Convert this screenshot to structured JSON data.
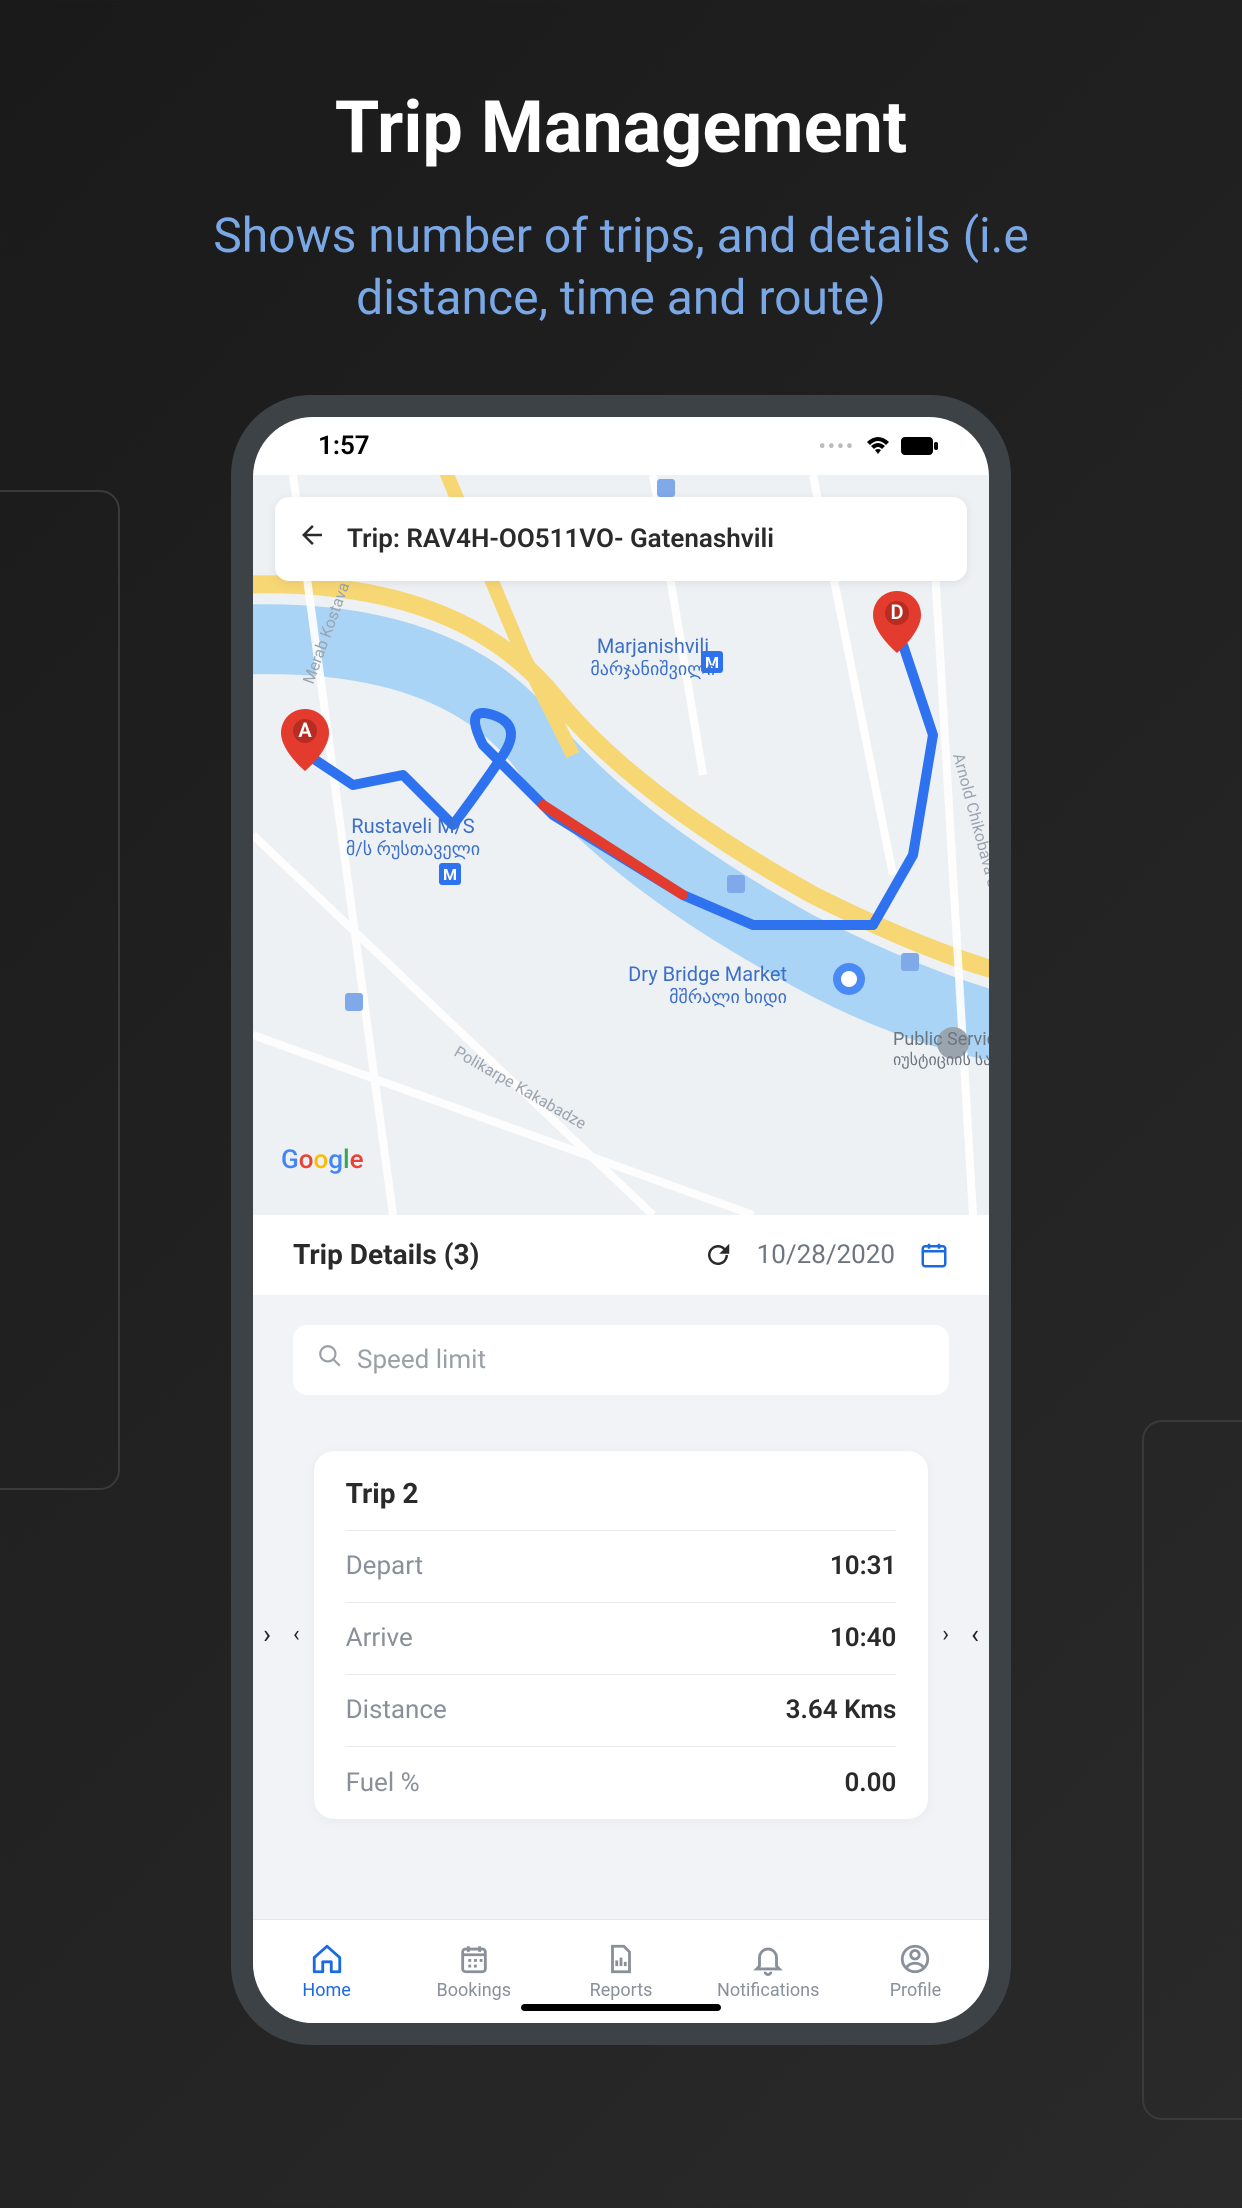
{
  "promo": {
    "title": "Trip Management",
    "subtitle": "Shows number of trips, and details (i.e distance, time and route)"
  },
  "status": {
    "time": "1:57"
  },
  "header": {
    "trip_title": "Trip: RAV4H-OO511VO- Gatenashvili"
  },
  "map": {
    "marker_a": "A",
    "marker_d": "D",
    "labels": {
      "marjanishvili_en": "Marjanishvili",
      "marjanishvili_ka": "მარჯანიშვილი",
      "rustaveli_en": "Rustaveli M/S",
      "rustaveli_ka": "მ/ს რუსთაველი",
      "drybridge_en": "Dry Bridge Market",
      "drybridge_ka": "მშრალი ხიდი",
      "service_hall_en": "Public Service Hall",
      "service_hall_ka": "იუსტიციის სახლი",
      "kostava": "Merab Kostava St",
      "kabadze": "Polikarpe Kakabadze",
      "chikobava": "Arnold Chikobava St"
    }
  },
  "details": {
    "title": "Trip Details (3)",
    "date": "10/28/2020"
  },
  "search": {
    "placeholder": "Speed limit"
  },
  "trip_card": {
    "title": "Trip 2",
    "rows": [
      {
        "label": "Depart",
        "value": "10:31"
      },
      {
        "label": "Arrive",
        "value": "10:40"
      },
      {
        "label": "Distance",
        "value": "3.64 Kms"
      },
      {
        "label": "Fuel %",
        "value": "0.00"
      }
    ]
  },
  "tabs": [
    {
      "label": "Home"
    },
    {
      "label": "Bookings"
    },
    {
      "label": "Reports"
    },
    {
      "label": "Notifications"
    },
    {
      "label": "Profile"
    }
  ]
}
